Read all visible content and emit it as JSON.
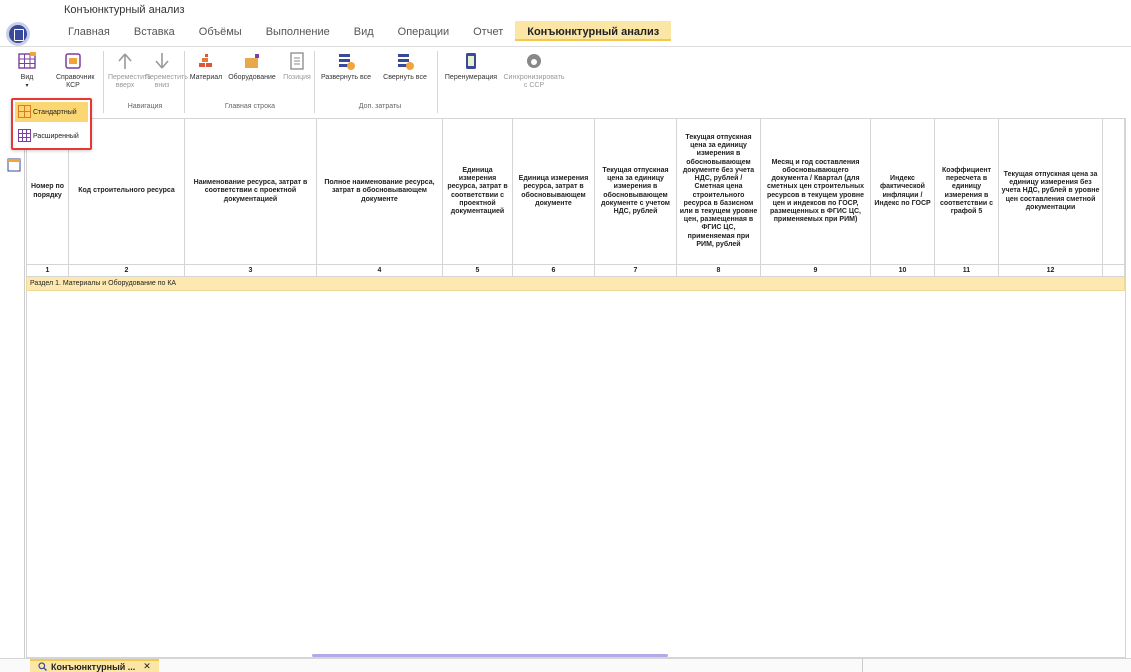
{
  "app": {
    "title": "Конъюнктурный анализ"
  },
  "menu": {
    "tabs": [
      "Главная",
      "Вставка",
      "Объёмы",
      "Выполнение",
      "Вид",
      "Операции",
      "Отчет",
      "Конъюнктурный анализ"
    ]
  },
  "ribbon": {
    "view_btn": "Вид",
    "ksr_btn": "Справочник КСР",
    "move_up": "Переместить вверх",
    "move_down": "Переместить вниз",
    "nav_group": "Навигация",
    "material": "Материал",
    "equipment": "Оборудование",
    "position": "Позиция",
    "main_row_group": "Главная строка",
    "expand_all": "Развернуть все",
    "collapse_all": "Свернуть все",
    "extra_group": "Доп. затраты",
    "renumber": "Перенумерация",
    "sync": "Синхронизировать с ССР"
  },
  "dropdown": {
    "items": [
      "Стандартный",
      "Расширенный"
    ]
  },
  "table": {
    "headers": [
      "Номер по порядку",
      "Код строительного ресурса",
      "Наименование ресурса, затрат в соответствии с проектной документацией",
      "Полное наименование ресурса, затрат в обосновывающем документе",
      "Единица измерения ресурса, затрат в соответствии с проектной документацией",
      "Единица измерения ресурса, затрат в обосновывающем документе",
      "Текущая отпускная цена за единицу измерения в обосновывающем документе с учетом НДС, рублей",
      "Текущая отпускная цена за единицу измерения в обосновывающем документе без учета НДС, рублей / Сметная цена строительного ресурса в базисном или в текущем уровне цен, размещенная в ФГИС ЦС, применяемая при РИМ, рублей",
      "Месяц и год составления обосновывающего документа / Квартал (для сметных цен строительных ресурсов в текущем уровне цен и индексов по ГОСР, размещенных в ФГИС ЦС, применяемых при РИМ)",
      "Индекс фактической инфляции / Индекс по ГОСР",
      "Коэффициент пересчета в единицу измерения в соответствии с графой 5",
      "Текущая отпускная цена за единицу измерения без учета НДС, рублей в уровне цен составления сметной документации"
    ],
    "col_numbers": [
      "1",
      "2",
      "3",
      "4",
      "5",
      "6",
      "7",
      "8",
      "9",
      "10",
      "11",
      "12"
    ],
    "section": "Раздел 1. Материалы и Оборудование по КА"
  },
  "status": {
    "doc_tab": "Конъюнктурный ...",
    "close": "✕"
  }
}
